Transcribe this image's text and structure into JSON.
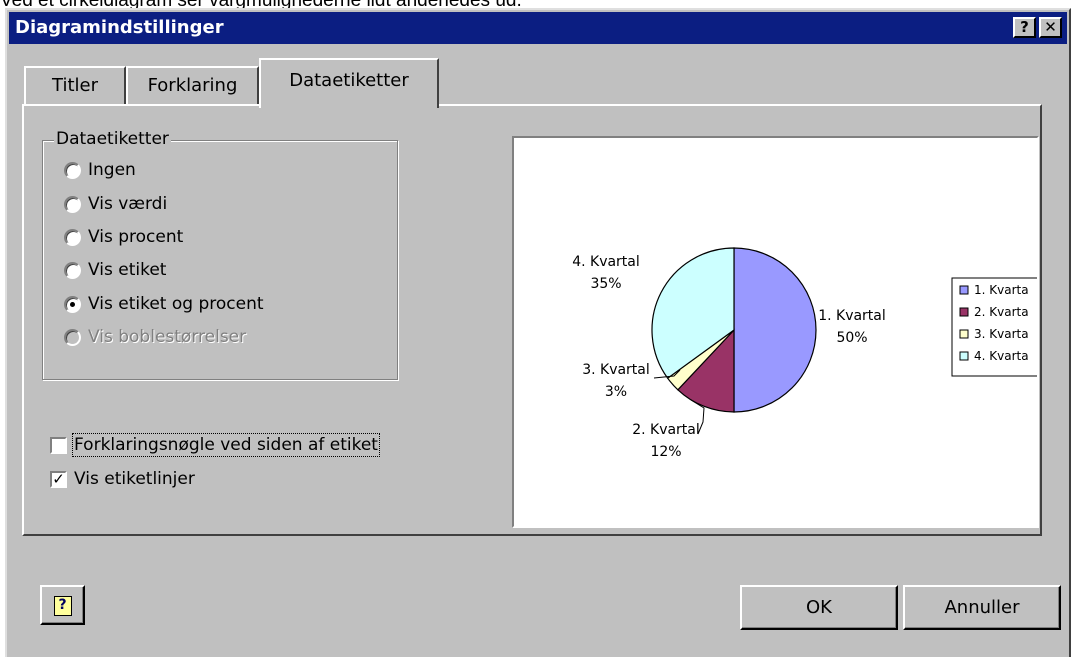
{
  "caption_text": "Ved et cirkeldiagram ser vargmulighederne lidt anderledes ud.",
  "dialog": {
    "title": "Diagramindstillinger",
    "help_btn": "?",
    "close_btn": "✕"
  },
  "tabs": [
    {
      "label": "Titler",
      "active": false
    },
    {
      "label": "Forklaring",
      "active": false
    },
    {
      "label": "Dataetiketter",
      "active": true
    }
  ],
  "group": {
    "legend": "Dataetiketter",
    "options": [
      {
        "label": "Ingen",
        "checked": false,
        "disabled": false
      },
      {
        "label": "Vis værdi",
        "checked": false,
        "disabled": false
      },
      {
        "label": "Vis procent",
        "checked": false,
        "disabled": false
      },
      {
        "label": "Vis etiket",
        "checked": false,
        "disabled": false
      },
      {
        "label": "Vis etiket og procent",
        "checked": true,
        "disabled": false
      },
      {
        "label": "Vis boblestørrelser",
        "checked": false,
        "disabled": true
      }
    ]
  },
  "checkboxes": [
    {
      "label": "Forklaringsnøgle ved siden af etiket",
      "checked": false
    },
    {
      "label": "Vis etiketlinjer",
      "checked": true
    }
  ],
  "buttons": {
    "ok": "OK",
    "cancel": "Annuller",
    "help_icon": "?"
  },
  "chart_data": {
    "type": "pie",
    "categories": [
      "1. Kvartal",
      "2. Kvartal",
      "3. Kvartal",
      "4. Kvartal"
    ],
    "values": [
      50,
      12,
      3,
      35
    ],
    "labels": [
      "1. Kvartal",
      "2. Kvartal",
      "3. Kvartal",
      "4. Kvartal"
    ],
    "percent_labels": [
      "50%",
      "12%",
      "3%",
      "35%"
    ],
    "colors": [
      "#9999ff",
      "#993366",
      "#ffffcc",
      "#ccffff"
    ],
    "legend": [
      "1. Kvarta",
      "2. Kvarta",
      "3. Kvarta",
      "4. Kvarta"
    ],
    "legend_position": "right"
  }
}
